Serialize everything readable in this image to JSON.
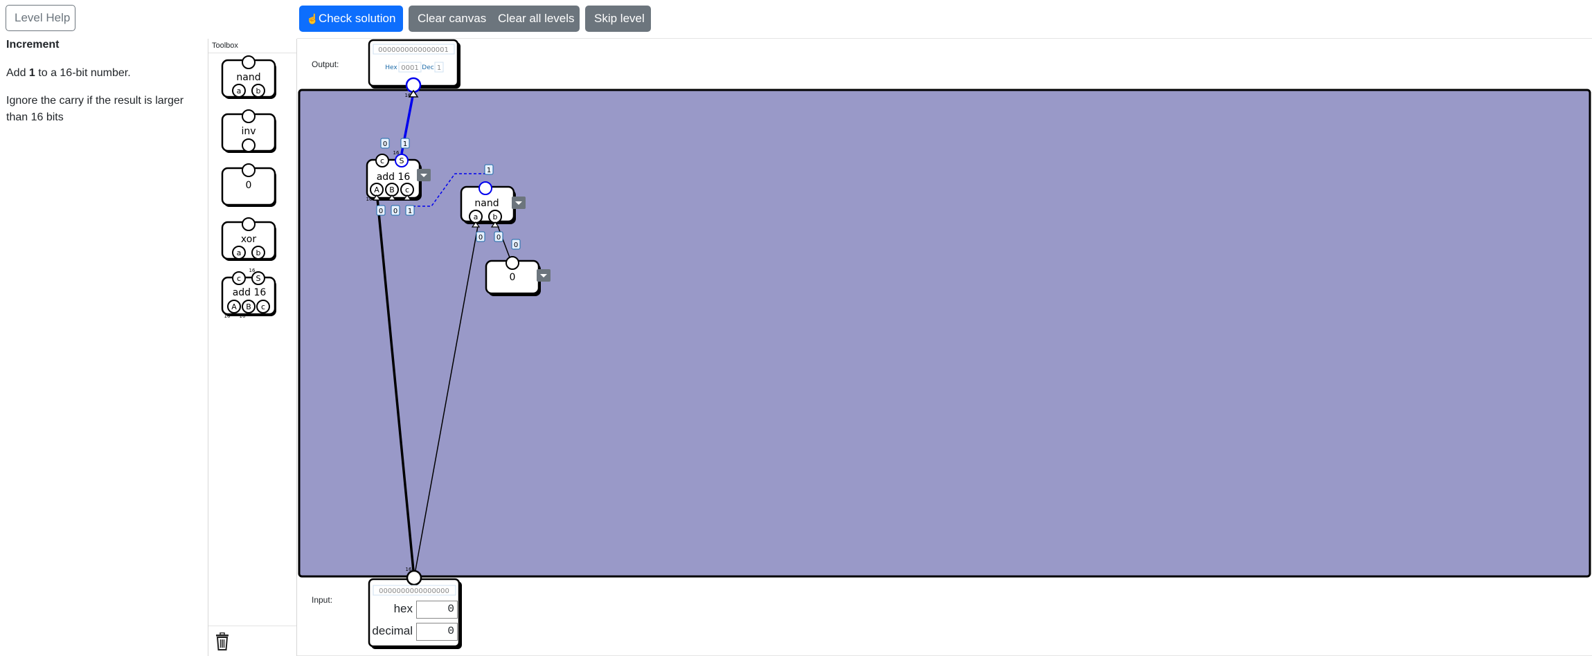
{
  "toolbar": {
    "level_help": "Level Help",
    "check_solution": "Check solution",
    "clear_canvas": "Clear canvas",
    "clear_all_levels": "Clear all levels",
    "skip_level": "Skip level"
  },
  "level": {
    "title": "Increment",
    "line1_pre": "Add ",
    "line1_bold": "1",
    "line1_post": " to a 16-bit number.",
    "line2": "Ignore the carry if the result is larger than 16 bits"
  },
  "toolbox": {
    "title": "Toolbox",
    "items": [
      {
        "label": "nand",
        "ports": [
          "a",
          "b"
        ]
      },
      {
        "label": "inv",
        "ports": []
      },
      {
        "label": "0",
        "ports": []
      },
      {
        "label": "xor",
        "ports": [
          "a",
          "b"
        ]
      },
      {
        "label": "add 16",
        "ports": [
          "A",
          "B",
          "c"
        ],
        "outputs": [
          "c",
          "S"
        ],
        "bus_width": "16"
      }
    ],
    "trash_icon": "trash-icon"
  },
  "output": {
    "label": "Output:",
    "bits": "0000000000000001",
    "hex_label": "Hex",
    "hex_value": "0001",
    "dec_label": "Dec",
    "dec_value": "1",
    "bus_width": "16"
  },
  "input": {
    "label": "Input:",
    "bits": "0000000000000000",
    "hex_label": "hex",
    "hex_value": "0",
    "decimal_label": "decimal",
    "decimal_value": "0",
    "bus_width": "16"
  },
  "canvas": {
    "background": "#9999c8",
    "components": {
      "adder": {
        "label": "add 16",
        "outputs": [
          "c",
          "S"
        ],
        "inputs": [
          "A",
          "B",
          "c"
        ],
        "out_values": [
          "0",
          "1"
        ],
        "in_values": [
          "0",
          "0",
          "1"
        ],
        "bus_width": "16"
      },
      "nand": {
        "label": "nand",
        "inputs": [
          "a",
          "b"
        ],
        "out_value": "1",
        "in_values": [
          "0",
          "0"
        ]
      },
      "const0": {
        "label": "0",
        "out_value": "0"
      }
    }
  },
  "colors": {
    "primary": "#0d6efd",
    "secondary": "#6c757d",
    "canvas": "#9999c8",
    "active_wire": "#0000ee"
  }
}
